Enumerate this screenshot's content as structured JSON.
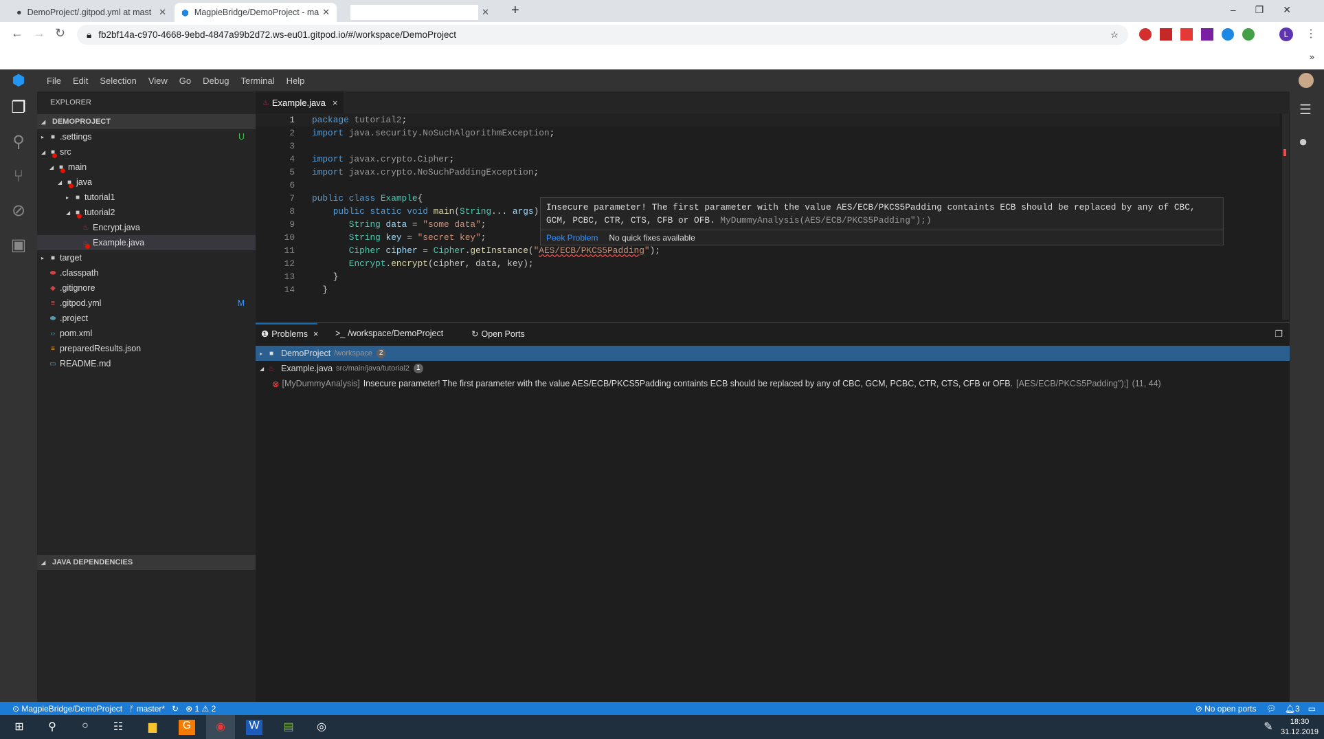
{
  "browser": {
    "tabs": [
      {
        "label": "DemoProject/.gitpod.yml at mast",
        "icon": "github-icon"
      },
      {
        "label": "MagpieBridge/DemoProject - ma",
        "icon": "gitpod-icon"
      },
      {
        "label": ""
      }
    ],
    "new_tab": "+",
    "url": "fb2bf14a-c970-4668-9ebd-4847a99b2d72.ws-eu01.gitpod.io/#/workspace/DemoProject",
    "extensions_more": "»",
    "profile": "L"
  },
  "menu": [
    "File",
    "Edit",
    "Selection",
    "View",
    "Go",
    "Debug",
    "Terminal",
    "Help"
  ],
  "explorer": {
    "title": "EXPLORER",
    "project": "DEMOPROJECT",
    "items": [
      {
        "label": ".settings",
        "depth": 0,
        "type": "folder",
        "caret": "▸",
        "badge": "U",
        "badge_color": "#3fb950"
      },
      {
        "label": "src",
        "depth": 0,
        "type": "folder",
        "caret": "◢",
        "error": true
      },
      {
        "label": "main",
        "depth": 1,
        "type": "folder",
        "caret": "◢",
        "error": true
      },
      {
        "label": "java",
        "depth": 2,
        "type": "folder",
        "caret": "◢",
        "error": true
      },
      {
        "label": "tutorial1",
        "depth": 3,
        "type": "folder",
        "caret": "▸"
      },
      {
        "label": "tutorial2",
        "depth": 3,
        "type": "folder",
        "caret": "◢",
        "error": true
      },
      {
        "label": "Encrypt.java",
        "depth": 4,
        "type": "java"
      },
      {
        "label": "Example.java",
        "depth": 4,
        "type": "java",
        "error": true,
        "selected": true
      },
      {
        "label": "target",
        "depth": 0,
        "type": "folder",
        "caret": "▸"
      },
      {
        "label": ".classpath",
        "depth": 0,
        "type": "classpath"
      },
      {
        "label": ".gitignore",
        "depth": 0,
        "type": "git"
      },
      {
        "label": ".gitpod.yml",
        "depth": 0,
        "type": "yml",
        "badge": "M",
        "badge_color": "#3794ff"
      },
      {
        "label": ".project",
        "depth": 0,
        "type": "project"
      },
      {
        "label": "pom.xml",
        "depth": 0,
        "type": "xml"
      },
      {
        "label": "preparedResults.json",
        "depth": 0,
        "type": "json"
      },
      {
        "label": "README.md",
        "depth": 0,
        "type": "md"
      }
    ],
    "java_deps": "JAVA DEPENDENCIES"
  },
  "editor": {
    "tab": "Example.java",
    "close": "×",
    "lines": [
      [
        [
          "kw",
          "package"
        ],
        [
          "gr",
          " tutorial2"
        ],
        [
          "",
          "; "
        ]
      ],
      [
        [
          "kw",
          "import"
        ],
        [
          "gr",
          " java.security.NoSuchAlgorithmException"
        ],
        [
          "",
          ";"
        ]
      ],
      [],
      [
        [
          "kw",
          "import"
        ],
        [
          "gr",
          " javax.crypto.Cipher"
        ],
        [
          "",
          ";"
        ]
      ],
      [
        [
          "kw",
          "import"
        ],
        [
          "gr",
          " javax.crypto.NoSuchPaddingException"
        ],
        [
          "",
          ";"
        ]
      ],
      [],
      [
        [
          "kw",
          "public class "
        ],
        [
          "ty",
          "Example"
        ],
        [
          "",
          "{"
        ]
      ],
      [
        [
          "",
          "    "
        ],
        [
          "kw",
          "public static void "
        ],
        [
          "fn",
          "main"
        ],
        [
          "",
          "("
        ],
        [
          "ty",
          "String"
        ],
        [
          "",
          "... "
        ],
        [
          "va",
          "args"
        ],
        [
          "",
          ")"
        ]
      ],
      [
        [
          "",
          "       "
        ],
        [
          "ty",
          "String "
        ],
        [
          "va",
          "data"
        ],
        [
          "",
          " = "
        ],
        [
          "st",
          "\"some data\""
        ],
        [
          "",
          ";"
        ]
      ],
      [
        [
          "",
          "       "
        ],
        [
          "ty",
          "String "
        ],
        [
          "va",
          "key"
        ],
        [
          "",
          " = "
        ],
        [
          "st",
          "\"secret key\""
        ],
        [
          "",
          ";"
        ]
      ],
      [
        [
          "",
          "       "
        ],
        [
          "ty",
          "Cipher "
        ],
        [
          "va",
          "cipher"
        ],
        [
          "",
          " = "
        ],
        [
          "ty",
          "Cipher"
        ],
        [
          "",
          "."
        ],
        [
          "fn",
          "getInstance"
        ],
        [
          "",
          "("
        ],
        [
          "st",
          "\""
        ],
        [
          "squig",
          "AES/ECB/PKCS5Padding"
        ],
        [
          "st",
          "\""
        ],
        [
          "",
          ");"
        ]
      ],
      [
        [
          "",
          "       "
        ],
        [
          "ty",
          "Encrypt"
        ],
        [
          "",
          "."
        ],
        [
          "fn",
          "encrypt"
        ],
        [
          "",
          "(cipher, data, key);"
        ]
      ],
      [
        [
          "",
          "    }"
        ]
      ],
      [
        [
          "",
          "  }"
        ]
      ]
    ],
    "hover": {
      "message": "Insecure parameter! The first parameter with the value AES/ECB/PKCS5Padding containts ECB should be replaced by any of CBC,",
      "message2": "GCM, PCBC, CTR, CTS, CFB or OFB. ",
      "source": "MyDummyAnalysis(AES/ECB/PKCS5Padding\");)",
      "peek": "Peek Problem",
      "no_fix": "No quick fixes available"
    }
  },
  "panel": {
    "tabs": [
      "Problems",
      "/workspace/DemoProject",
      "Open Ports"
    ],
    "terminal_prefix": ">_",
    "close": "×",
    "root": {
      "label": "DemoProject",
      "path": "/workspace",
      "count": "2"
    },
    "file": {
      "label": "Example.java",
      "path": "src/main/java/tutorial2",
      "count": "1"
    },
    "problem": {
      "source": "[MyDummyAnalysis]",
      "message": "Insecure parameter! The first parameter with the value AES/ECB/PKCS5Padding containts ECB should be replaced by any of CBC, GCM, PCBC, CTR, CTS, CFB or OFB.",
      "code": "[AES/ECB/PKCS5Padding\");]",
      "position": "(11, 44)"
    }
  },
  "status": {
    "repo": "MagpieBridge/DemoProject",
    "branch": "master*",
    "errors": "1",
    "warnings": "2",
    "ports": "No open ports",
    "notifications": "3"
  },
  "taskbar": {
    "time": "18:30",
    "date": "31.12.2019"
  }
}
